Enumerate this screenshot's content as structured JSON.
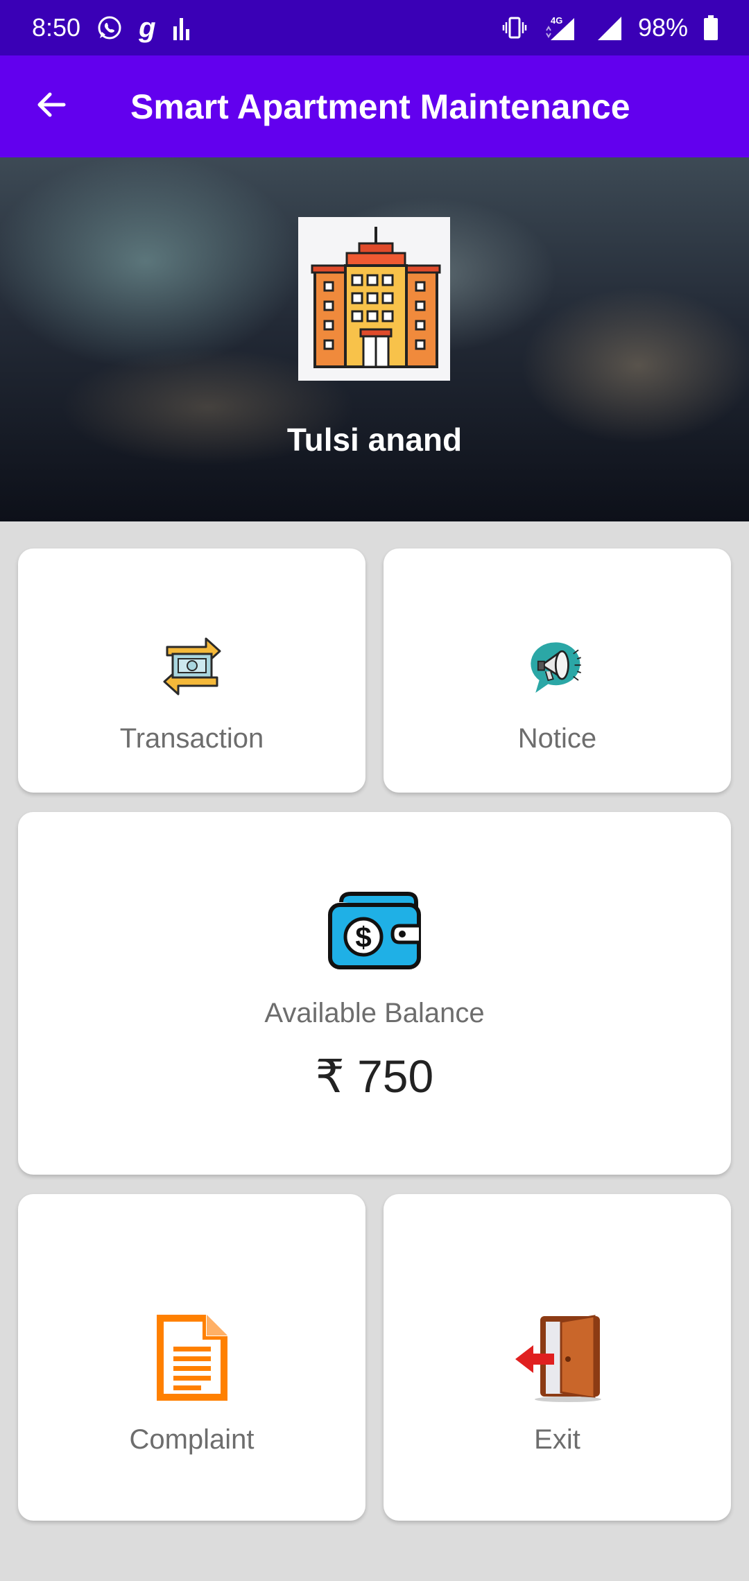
{
  "status_bar": {
    "time": "8:50",
    "battery": "98%",
    "network": "4G",
    "icons": [
      "whatsapp-icon",
      "g-icon",
      "signal-bars-icon",
      "vibrate-icon",
      "mobile-signal-icon",
      "wifi-signal-icon",
      "battery-icon"
    ]
  },
  "app_bar": {
    "title": "Smart Apartment Maintenance",
    "back_icon": "arrow-left-icon"
  },
  "hero": {
    "user_name": "Tulsi anand",
    "logo_icon": "building-icon"
  },
  "cards": {
    "transaction": {
      "label": "Transaction",
      "icon": "money-transfer-icon"
    },
    "notice": {
      "label": "Notice",
      "icon": "megaphone-icon"
    },
    "balance": {
      "label": "Available Balance",
      "amount": "₹ 750",
      "icon": "wallet-icon"
    },
    "complaint": {
      "label": "Complaint",
      "icon": "document-icon"
    },
    "exit": {
      "label": "Exit",
      "icon": "exit-door-icon"
    }
  },
  "colors": {
    "status_bar": "#3a00b6",
    "app_bar": "#6200ee",
    "background": "#dcdcdc",
    "card": "#ffffff",
    "label_text": "#6d6d6d"
  }
}
